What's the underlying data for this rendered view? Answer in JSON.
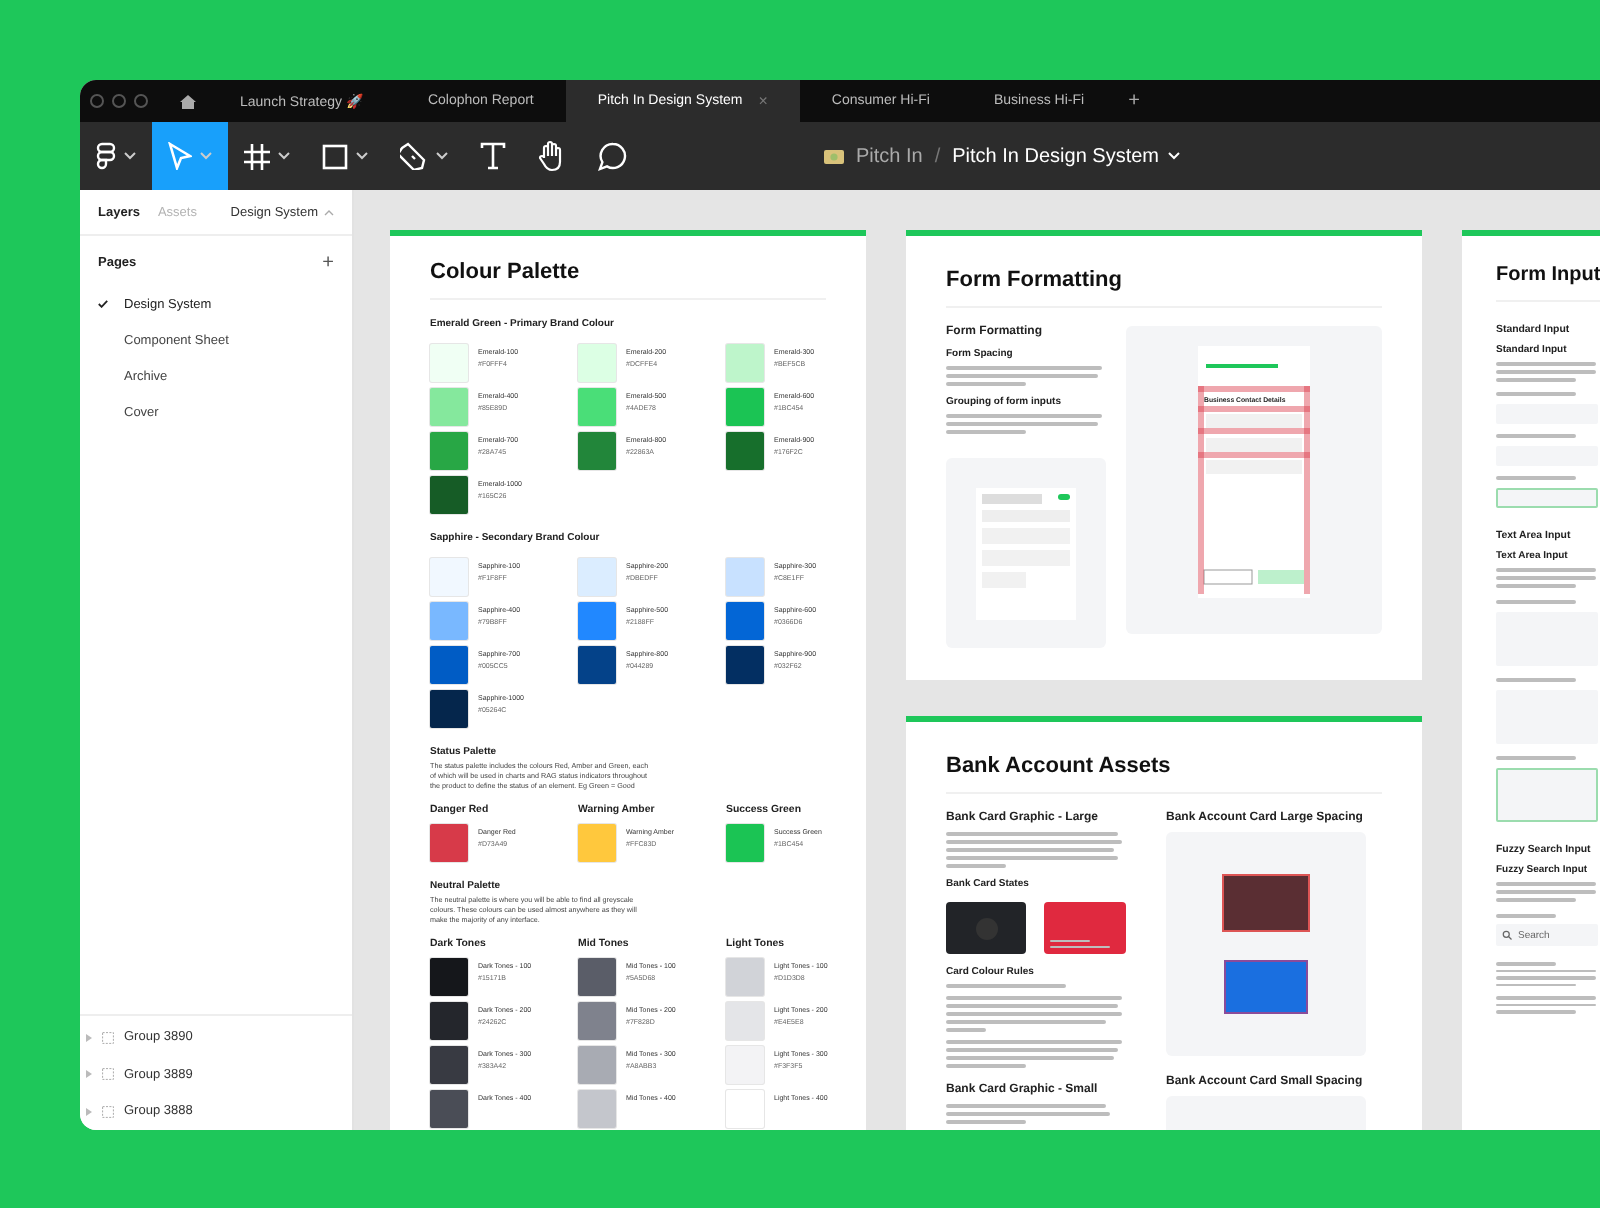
{
  "tabs": [
    {
      "label": "Launch Strategy 🚀",
      "selected": false
    },
    {
      "label": "Colophon Report",
      "selected": false
    },
    {
      "label": "Pitch In Design System",
      "selected": true,
      "close": "×"
    },
    {
      "label": "Consumer Hi-Fi",
      "selected": false
    },
    {
      "label": "Business Hi-Fi",
      "selected": false
    }
  ],
  "new_tab": "+",
  "toolbar": {
    "tools": [
      {
        "kind": "menu",
        "selected": false
      },
      {
        "kind": "move",
        "selected": true
      },
      {
        "kind": "frame",
        "selected": false
      },
      {
        "kind": "shape",
        "selected": false
      },
      {
        "kind": "pen",
        "selected": false
      },
      {
        "kind": "text",
        "selected": false
      },
      {
        "kind": "hand",
        "selected": false
      },
      {
        "kind": "comment",
        "selected": false
      }
    ],
    "breadcrumb": {
      "team": "Pitch In",
      "separator": "/",
      "file": "Pitch In Design System"
    }
  },
  "sidebar": {
    "tabs": [
      {
        "label": "Layers",
        "selected": true
      },
      {
        "label": "Assets",
        "selected": false
      }
    ],
    "page_menu": "Design System",
    "pages_heading": "Pages",
    "add": "+",
    "pages": [
      {
        "label": "Design System",
        "selected": true
      },
      {
        "label": "Component Sheet",
        "selected": false
      },
      {
        "label": "Archive",
        "selected": false
      },
      {
        "label": "Cover",
        "selected": false
      }
    ],
    "layers": [
      {
        "label": "Group 3890"
      },
      {
        "label": "Group 3889"
      },
      {
        "label": "Group 3888"
      }
    ]
  },
  "colour_palette": {
    "title": "Colour Palette",
    "sections": [
      {
        "kind": "grid",
        "heading": "Emerald Green - Primary Brand Colour",
        "swatches": [
          {
            "name": "Emerald-100",
            "hex": "#F0FFF4",
            "color": "#f0fff4"
          },
          {
            "name": "Emerald-200",
            "hex": "#DCFFE4",
            "color": "#dcffe4"
          },
          {
            "name": "Emerald-300",
            "hex": "#BEF5CB",
            "color": "#bef5cb"
          },
          {
            "name": "Emerald-400",
            "hex": "#85E89D",
            "color": "#85e89d"
          },
          {
            "name": "Emerald-500",
            "hex": "#4ADE78",
            "color": "#4ade78"
          },
          {
            "name": "Emerald-600",
            "hex": "#1BC454",
            "color": "#1bc454"
          },
          {
            "name": "Emerald-700",
            "hex": "#28A745",
            "color": "#28a745"
          },
          {
            "name": "Emerald-800",
            "hex": "#22863A",
            "color": "#22863a"
          },
          {
            "name": "Emerald-900",
            "hex": "#176F2C",
            "color": "#176f2c"
          },
          {
            "name": "Emerald-1000",
            "hex": "#165C26",
            "color": "#165c26"
          }
        ]
      },
      {
        "kind": "grid",
        "heading": "Sapphire - Secondary Brand Colour",
        "swatches": [
          {
            "name": "Sapphire-100",
            "hex": "#F1F8FF",
            "color": "#f1f8ff"
          },
          {
            "name": "Sapphire-200",
            "hex": "#DBEDFF",
            "color": "#dbedff"
          },
          {
            "name": "Sapphire-300",
            "hex": "#C8E1FF",
            "color": "#c8e1ff"
          },
          {
            "name": "Sapphire-400",
            "hex": "#79B8FF",
            "color": "#79b8ff"
          },
          {
            "name": "Sapphire-500",
            "hex": "#2188FF",
            "color": "#2188ff"
          },
          {
            "name": "Sapphire-600",
            "hex": "#0366D6",
            "color": "#0366d6"
          },
          {
            "name": "Sapphire-700",
            "hex": "#005CC5",
            "color": "#005cc5"
          },
          {
            "name": "Sapphire-800",
            "hex": "#044289",
            "color": "#044289"
          },
          {
            "name": "Sapphire-900",
            "hex": "#032F62",
            "color": "#032f62"
          },
          {
            "name": "Sapphire-1000",
            "hex": "#05264C",
            "color": "#05264c"
          }
        ]
      },
      {
        "kind": "columns",
        "heading": "Status Palette",
        "text": "The status palette includes the colours Red, Amber and Green, each of which will be used in charts and RAG status indicators throughout the product to define the status of an element. Eg Green = Good",
        "columns": [
          {
            "heading": "Danger Red",
            "swatches": [
              {
                "name": "Danger Red",
                "hex": "#D73A49",
                "color": "#d73a49"
              }
            ]
          },
          {
            "heading": "Warning Amber",
            "swatches": [
              {
                "name": "Warning Amber",
                "hex": "#FFC83D",
                "color": "#ffc83d"
              }
            ]
          },
          {
            "heading": "Success Green",
            "swatches": [
              {
                "name": "Success Green",
                "hex": "#1BC454",
                "color": "#1bc454"
              }
            ]
          }
        ]
      },
      {
        "kind": "columns",
        "heading": "Neutral Palette",
        "text": "The neutral palette is where you will be able to find all greyscale colours. These colours can be used almost anywhere as they will make the majority of any interface.",
        "columns": [
          {
            "heading": "Dark Tones",
            "swatches": [
              {
                "name": "Dark Tones - 100",
                "hex": "#15171B",
                "color": "#15171b"
              },
              {
                "name": "Dark Tones - 200",
                "hex": "#24262C",
                "color": "#24262c"
              },
              {
                "name": "Dark Tones - 300",
                "hex": "#383A42",
                "color": "#383a42"
              },
              {
                "name": "Dark Tones - 400",
                "color": "#4a4d56"
              }
            ]
          },
          {
            "heading": "Mid Tones",
            "swatches": [
              {
                "name": "Mid Tones - 100",
                "hex": "#5A5D68",
                "color": "#5a5d68"
              },
              {
                "name": "Mid Tones - 200",
                "hex": "#7F828D",
                "color": "#7f828d"
              },
              {
                "name": "Mid Tones - 300",
                "hex": "#A8ABB3",
                "color": "#a8abb3"
              },
              {
                "name": "Mid Tones - 400",
                "color": "#c4c6cc"
              }
            ]
          },
          {
            "heading": "Light Tones",
            "swatches": [
              {
                "name": "Light Tones - 100",
                "hex": "#D1D3D8",
                "color": "#d1d3d8"
              },
              {
                "name": "Light Tones - 200",
                "hex": "#E4E5E8",
                "color": "#e4e5e8"
              },
              {
                "name": "Light Tones - 300",
                "hex": "#F3F3F5",
                "color": "#f3f3f5"
              },
              {
                "name": "Light Tones - 400",
                "color": "#ffffff"
              }
            ]
          }
        ]
      }
    ]
  },
  "form_formatting": {
    "title": "Form Formatting",
    "subtitle": "Form Formatting",
    "headings": [
      "Form Spacing",
      "Grouping of form inputs"
    ],
    "mock_heading": "Business Contact Details"
  },
  "bank_account": {
    "title": "Bank Account Assets",
    "large_heading": "Bank Card Graphic - Large",
    "states_heading": "Bank Card States",
    "rules_heading": "Card Colour Rules",
    "small_heading": "Bank Card Graphic - Small",
    "large_spacing_heading": "Bank Account Card Large Spacing",
    "small_spacing_heading": "Bank Account Card Small Spacing"
  },
  "form_input": {
    "title": "Form Input",
    "sections": [
      {
        "kind": "fields",
        "heading": "Standard Input",
        "subheading": "Standard Input"
      },
      {
        "kind": "areas",
        "heading": "Text Area Input",
        "subheading": "Text Area Input"
      },
      {
        "kind": "search",
        "heading": "Fuzzy Search Input",
        "subheading": "Fuzzy Search Input",
        "placeholder": "Search"
      }
    ]
  }
}
